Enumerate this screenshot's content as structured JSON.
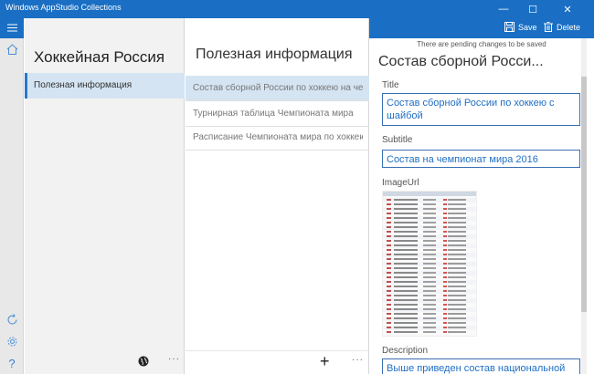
{
  "window": {
    "title": "Windows AppStudio Collections",
    "minimize_glyph": "—",
    "maximize_glyph": "☐",
    "close_glyph": "✕"
  },
  "commandbar": {
    "save_label": "Save",
    "delete_label": "Delete"
  },
  "rail": {
    "help_glyph": "?"
  },
  "collections": {
    "header": "Хоккейная Россия",
    "items": [
      {
        "label": "Полезная информация"
      }
    ],
    "more_glyph": "···"
  },
  "items": {
    "header": "Полезная информация",
    "rows": [
      {
        "label": "Состав сборной России по хоккею на чемпионат мира"
      },
      {
        "label": "Турнирная таблица Чемпионата мира"
      },
      {
        "label": "Расписание Чемпионата мира по хоккею"
      }
    ],
    "add_glyph": "+",
    "more_glyph": "···"
  },
  "detail": {
    "pending_notice": "There are pending changes to be saved",
    "title": "Состав сборной Росси...",
    "fields": {
      "title_label": "Title",
      "title_value": "Состав сборной России по хоккею с шайбой",
      "subtitle_label": "Subtitle",
      "subtitle_value": "Состав на чемпионат мира 2016",
      "imageurl_label": "ImageUrl",
      "description_label": "Description",
      "description_value": "Выше приведен состав национальной"
    }
  },
  "colors": {
    "accent": "#1a6fc4",
    "selection": "#d4e4f2"
  }
}
